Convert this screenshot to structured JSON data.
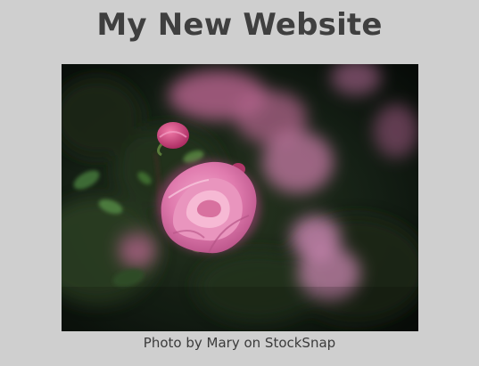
{
  "header": {
    "title": "My New Website"
  },
  "figure": {
    "image_subject": "pink-rose-photo",
    "caption": "Photo by Mary on StockSnap"
  },
  "colors": {
    "background": "#cfcfcf",
    "title_text": "#3f3f3f",
    "caption_text": "#3b3b3b",
    "rose_pink": "#d96aa0"
  }
}
